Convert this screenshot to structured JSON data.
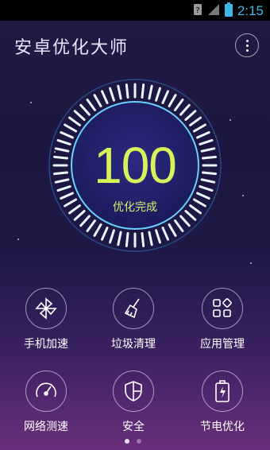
{
  "status_bar": {
    "time": "2:15"
  },
  "app": {
    "title": "安卓优化大师"
  },
  "score": {
    "value": "100",
    "label": "优化完成"
  },
  "tiles": [
    {
      "label": "手机加速",
      "icon": "pinwheel-icon"
    },
    {
      "label": "垃圾清理",
      "icon": "broom-icon"
    },
    {
      "label": "应用管理",
      "icon": "apps-grid-icon"
    },
    {
      "label": "网络测速",
      "icon": "speedometer-icon"
    },
    {
      "label": "安全",
      "icon": "shield-icon"
    },
    {
      "label": "节电优化",
      "icon": "battery-charge-icon"
    }
  ],
  "pager": {
    "pages": 2,
    "active": 1
  },
  "colors": {
    "accent_ring": "#3aa8ff",
    "score_text": "#d8f25a",
    "status_time": "#3fb6e6"
  }
}
